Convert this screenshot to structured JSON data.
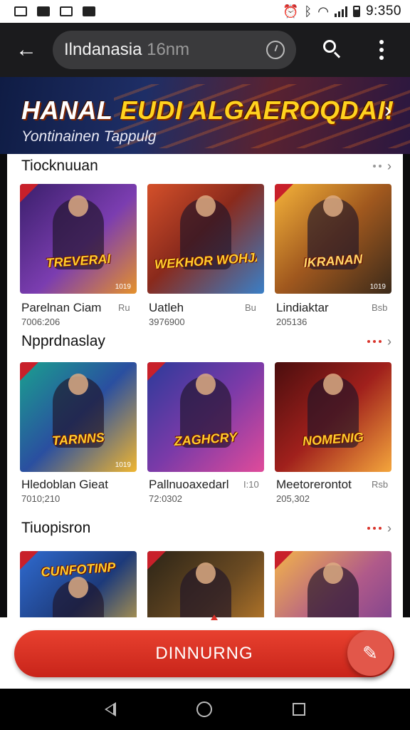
{
  "status_bar": {
    "time": "9:350"
  },
  "app_bar": {
    "search_text": "Ilndanasia",
    "search_hint": "16nm"
  },
  "banner": {
    "title_part1": "HANAL",
    "title_part2": "EUDI ALGAEROQDAI!",
    "subtitle": "Yontinainen Tappulg"
  },
  "sections": [
    {
      "title": "Tiocknuuan",
      "games": [
        {
          "name": "Parelnan Ciam",
          "meta": "7006:206",
          "side": "Ru",
          "logo": "TREVERAI",
          "tag": "1019",
          "colors": [
            "#5b2a86",
            "#e79a2b"
          ]
        },
        {
          "name": "Uatleh",
          "meta": "3976900",
          "side": "Bu",
          "logo": "WEKHOR WOHJANS",
          "tag": "",
          "colors": [
            "#b8412a",
            "#3a7fc7"
          ]
        },
        {
          "name": "Lindiaktar",
          "meta": "205136",
          "side": "Bsb",
          "logo": "IKRANAN",
          "tag": "1019",
          "colors": [
            "#f2a72a",
            "#3b2a1a"
          ]
        }
      ]
    },
    {
      "title": "Npprdnaslay",
      "games": [
        {
          "name": "Hledoblan Gieat",
          "meta": "7010;210",
          "side": "",
          "logo": "TARNNS",
          "tag": "1019",
          "colors": [
            "#1d9b8d",
            "#f0b630"
          ]
        },
        {
          "name": "Pallnuoaxedarl",
          "meta": "72:0302",
          "side": "I:10",
          "logo": "ZAGHCRY",
          "tag": "",
          "colors": [
            "#3b3ea0",
            "#e04b9a"
          ]
        },
        {
          "name": "Meetorerontot",
          "meta": "205,302",
          "side": "Rsb",
          "logo": "NOMENIG",
          "tag": "",
          "colors": [
            "#a0201c",
            "#f4a63c"
          ]
        }
      ]
    },
    {
      "title": "Tiuopisron",
      "games": [
        {
          "name": "",
          "meta": "",
          "side": "",
          "logo": "CUNFOTINP",
          "tag": "",
          "colors": [
            "#2f6bd0",
            "#f2c03a"
          ]
        },
        {
          "name": "",
          "meta": "",
          "side": "",
          "logo": "",
          "tag": "",
          "colors": [
            "#2b2417",
            "#d58a2c"
          ]
        },
        {
          "name": "",
          "meta": "",
          "side": "",
          "logo": "",
          "tag": "",
          "colors": [
            "#f3b44a",
            "#6b3a8f"
          ]
        }
      ]
    }
  ],
  "cta": {
    "label": "DINNURNG"
  },
  "colors": {
    "accent": "#d9342b",
    "appbar": "#1b1b1d"
  },
  "icons": [
    "back-arrow-icon",
    "clock-icon",
    "search-icon",
    "more-vert-icon",
    "chevron-right-icon",
    "pencil-icon",
    "nav-back-icon",
    "nav-home-icon",
    "nav-recent-icon"
  ]
}
